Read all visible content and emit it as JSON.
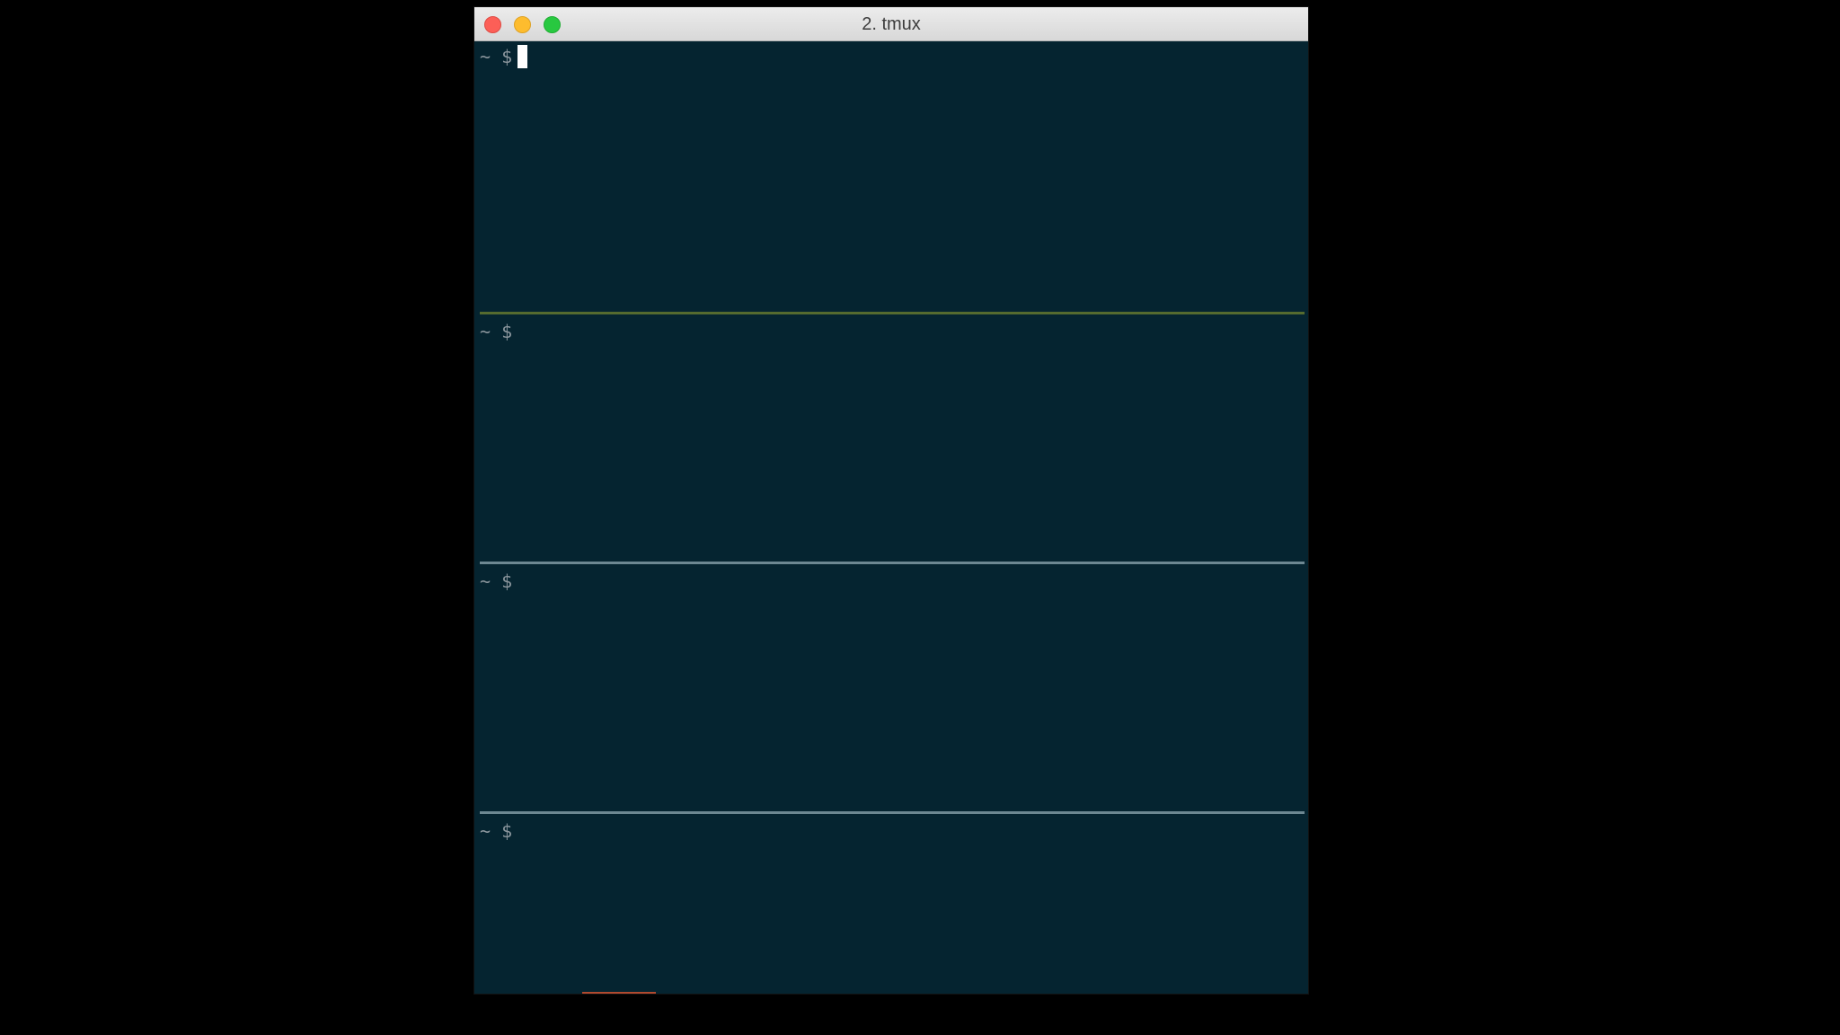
{
  "window": {
    "title": "2. tmux"
  },
  "panes": [
    {
      "prompt": "~ $",
      "active": true,
      "cursor": true
    },
    {
      "prompt": "~ $",
      "active": false,
      "cursor": false
    },
    {
      "prompt": "~ $",
      "active": false,
      "cursor": false
    },
    {
      "prompt": "~ $",
      "active": false,
      "cursor": false
    }
  ],
  "colors": {
    "terminal_background": "#052430",
    "prompt_text": "#8a959c",
    "active_pane_border": "#556b2f",
    "inactive_pane_border": "#6d8892",
    "close_button": "#fc5f57",
    "minimize_button": "#fdbc2e",
    "zoom_button": "#28c840"
  }
}
